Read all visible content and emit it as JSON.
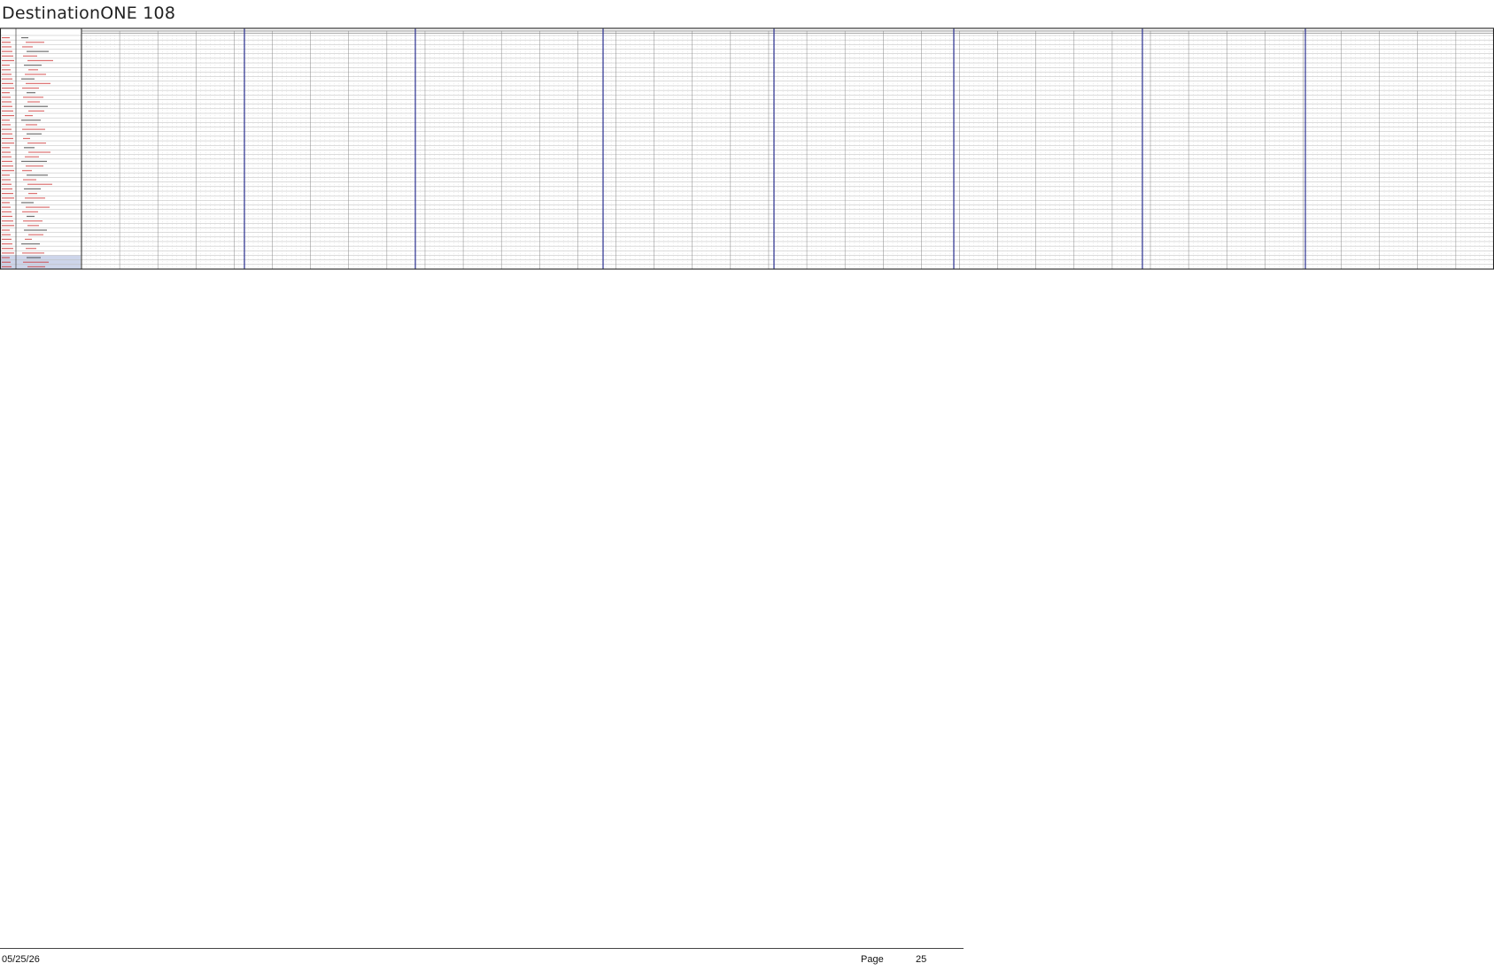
{
  "document": {
    "title": "DestinationONE 108"
  },
  "footer": {
    "date": "05/25/26",
    "page_label": "Page",
    "page_number": "25"
  },
  "colors": {
    "major_divider": "#2a2f8f",
    "grid_line": "#b8b8b8",
    "frame": "#222222",
    "left_panel_text_red": "#cc3333",
    "left_panel_text_dark": "#333333",
    "summary_row_fill": "#cdd5ea"
  }
}
